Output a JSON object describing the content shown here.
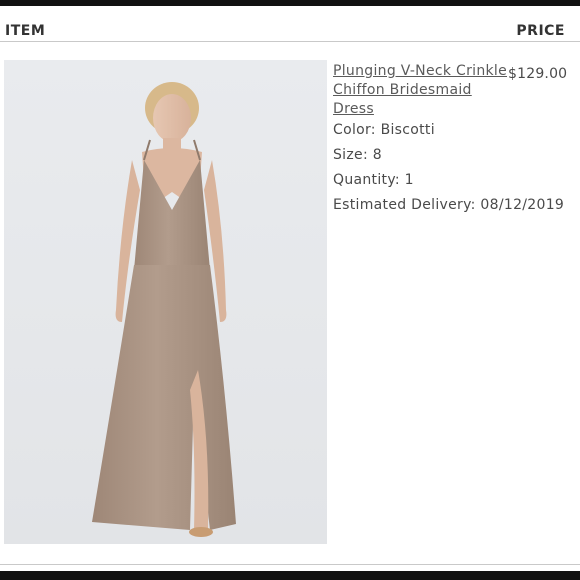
{
  "header": {
    "item_label": "ITEM",
    "price_label": "PRICE"
  },
  "product": {
    "title": "Plunging V-Neck Crinkle Chiffon Bridesmaid Dress",
    "price": "$129.00",
    "color": "Color: Biscotti",
    "size": "Size: 8",
    "quantity": "Quantity: 1",
    "delivery": "Estimated Delivery: 08/12/2019",
    "image_alt": "bridesmaid-dress-photo"
  },
  "colors": {
    "bars": "#111111",
    "rule": "#c9c9c9",
    "text": "#4a4a4a",
    "dress": "#a99283",
    "photo_bg": "#e6e8eb"
  }
}
